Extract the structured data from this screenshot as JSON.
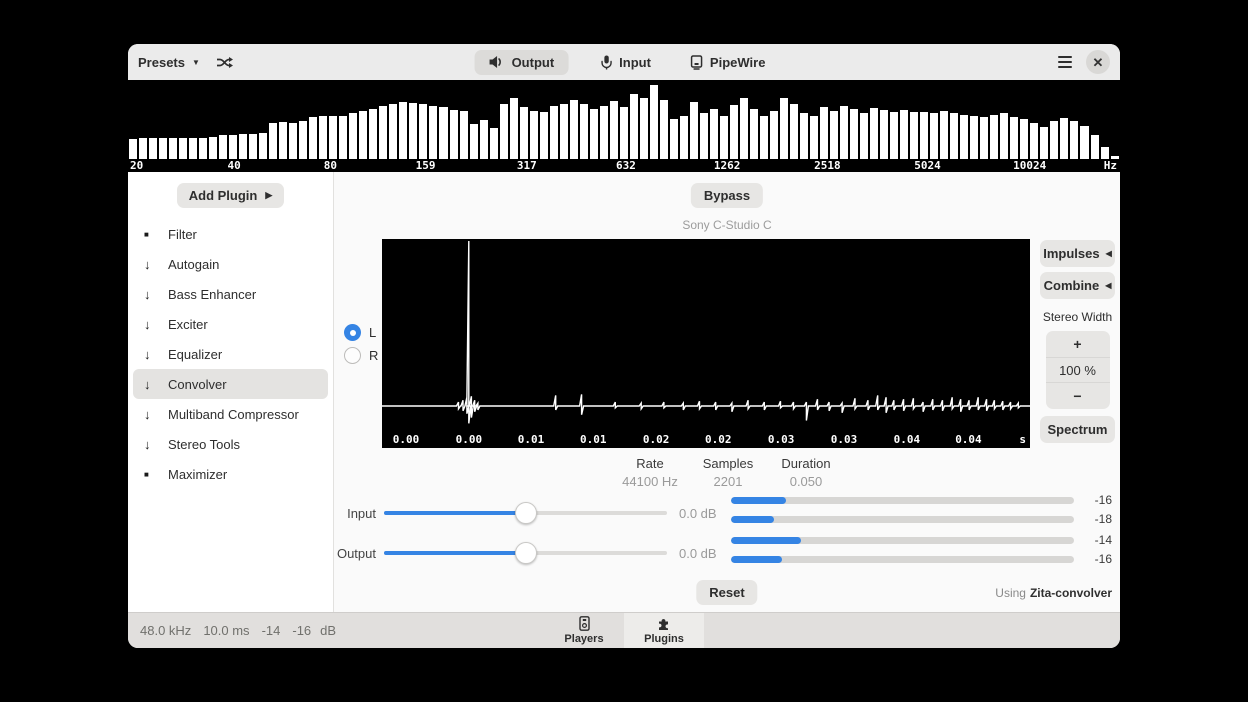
{
  "colors": {
    "accent": "#3584e4",
    "bar_fill": "#ffffff"
  },
  "header": {
    "presets_label": "Presets",
    "tabs": [
      {
        "label": "Output",
        "icon": "speaker-icon",
        "selected": true
      },
      {
        "label": "Input",
        "icon": "microphone-icon",
        "selected": false
      },
      {
        "label": "PipeWire",
        "icon": "device-icon",
        "selected": false
      }
    ]
  },
  "spectrum": {
    "freq_labels": [
      "20",
      "40",
      "80",
      "159",
      "317",
      "632",
      "1262",
      "2518",
      "5024",
      "10024"
    ],
    "label_positions_pct": [
      0.2,
      10.7,
      20.4,
      30.0,
      40.2,
      50.2,
      60.4,
      70.5,
      80.6,
      90.9
    ],
    "unit": "Hz",
    "bars": [
      0.26,
      0.27,
      0.27,
      0.28,
      0.28,
      0.27,
      0.28,
      0.28,
      0.29,
      0.31,
      0.32,
      0.33,
      0.33,
      0.34,
      0.48,
      0.49,
      0.48,
      0.5,
      0.55,
      0.56,
      0.57,
      0.56,
      0.6,
      0.63,
      0.66,
      0.7,
      0.73,
      0.75,
      0.74,
      0.72,
      0.7,
      0.68,
      0.64,
      0.63,
      0.46,
      0.51,
      0.41,
      0.72,
      0.8,
      0.69,
      0.63,
      0.62,
      0.7,
      0.72,
      0.78,
      0.73,
      0.66,
      0.7,
      0.76,
      0.68,
      0.85,
      0.8,
      0.98,
      0.78,
      0.52,
      0.56,
      0.75,
      0.61,
      0.66,
      0.56,
      0.71,
      0.8,
      0.66,
      0.56,
      0.63,
      0.8,
      0.73,
      0.61,
      0.56,
      0.68,
      0.63,
      0.7,
      0.66,
      0.61,
      0.67,
      0.64,
      0.62,
      0.64,
      0.62,
      0.62,
      0.6,
      0.63,
      0.6,
      0.58,
      0.56,
      0.55,
      0.58,
      0.6,
      0.55,
      0.52,
      0.48,
      0.42,
      0.5,
      0.54,
      0.5,
      0.44,
      0.32,
      0.16,
      0.04
    ]
  },
  "sidebar": {
    "add_plugin_label": "Add Plugin",
    "items": [
      {
        "label": "Filter",
        "icon": "square",
        "selected": false
      },
      {
        "label": "Autogain",
        "icon": "arrow-down",
        "selected": false
      },
      {
        "label": "Bass Enhancer",
        "icon": "arrow-down",
        "selected": false
      },
      {
        "label": "Exciter",
        "icon": "arrow-down",
        "selected": false
      },
      {
        "label": "Equalizer",
        "icon": "arrow-down",
        "selected": false
      },
      {
        "label": "Convolver",
        "icon": "arrow-down",
        "selected": true
      },
      {
        "label": "Multiband Compressor",
        "icon": "arrow-down",
        "selected": false
      },
      {
        "label": "Stereo Tools",
        "icon": "arrow-down",
        "selected": false
      },
      {
        "label": "Maximizer",
        "icon": "square",
        "selected": false
      }
    ]
  },
  "main": {
    "bypass_label": "Bypass",
    "preset_name": "Sony C-Studio C",
    "channels": [
      {
        "label": "L",
        "selected": true
      },
      {
        "label": "R",
        "selected": false
      }
    ],
    "waveform": {
      "time_labels": [
        "0.00",
        "0.00",
        "0.01",
        "0.01",
        "0.02",
        "0.02",
        "0.03",
        "0.03",
        "0.04",
        "0.04"
      ],
      "label_positions_pct": [
        3.7,
        13.4,
        23.0,
        32.6,
        42.3,
        51.9,
        61.6,
        71.3,
        81.0,
        90.5
      ],
      "unit": "s",
      "baseline_frac": 0.865,
      "spikes": [
        [
          0.118,
          0.02,
          0.015
        ],
        [
          0.125,
          0.03,
          0.025
        ],
        [
          0.131,
          0.045,
          0.04
        ],
        [
          0.134,
          0.855,
          0.09
        ],
        [
          0.138,
          0.05,
          0.06
        ],
        [
          0.143,
          0.03,
          0.03
        ],
        [
          0.148,
          0.015,
          0.02
        ],
        [
          0.268,
          0.055,
          0.02
        ],
        [
          0.308,
          0.06,
          0.045
        ],
        [
          0.36,
          0.02,
          0.01
        ],
        [
          0.4,
          0.015,
          0.015
        ],
        [
          0.435,
          0.02,
          0.01
        ],
        [
          0.465,
          0.015,
          0.02
        ],
        [
          0.49,
          0.025,
          0.015
        ],
        [
          0.515,
          0.02,
          0.02
        ],
        [
          0.54,
          0.015,
          0.03
        ],
        [
          0.565,
          0.03,
          0.015
        ],
        [
          0.59,
          0.02,
          0.02
        ],
        [
          0.615,
          0.025,
          0.01
        ],
        [
          0.635,
          0.02,
          0.015
        ],
        [
          0.655,
          0.02,
          0.075
        ],
        [
          0.672,
          0.035,
          0.02
        ],
        [
          0.69,
          0.02,
          0.025
        ],
        [
          0.71,
          0.015,
          0.035
        ],
        [
          0.73,
          0.04,
          0.015
        ],
        [
          0.75,
          0.03,
          0.02
        ],
        [
          0.765,
          0.055,
          0.02
        ],
        [
          0.778,
          0.045,
          0.035
        ],
        [
          0.79,
          0.03,
          0.02
        ],
        [
          0.805,
          0.035,
          0.025
        ],
        [
          0.82,
          0.04,
          0.015
        ],
        [
          0.835,
          0.02,
          0.03
        ],
        [
          0.85,
          0.035,
          0.02
        ],
        [
          0.865,
          0.03,
          0.025
        ],
        [
          0.88,
          0.045,
          0.015
        ],
        [
          0.893,
          0.035,
          0.03
        ],
        [
          0.906,
          0.03,
          0.02
        ],
        [
          0.92,
          0.045,
          0.02
        ],
        [
          0.933,
          0.035,
          0.025
        ],
        [
          0.945,
          0.03,
          0.015
        ],
        [
          0.958,
          0.025,
          0.02
        ],
        [
          0.97,
          0.02,
          0.015
        ],
        [
          0.982,
          0.015,
          0.01
        ]
      ]
    },
    "right_panel": {
      "impulses_label": "Impulses",
      "combine_label": "Combine",
      "stereo_width_label": "Stereo Width",
      "plus_label": "+",
      "stereo_width_value": "100 %",
      "minus_label": "−",
      "spectrum_label": "Spectrum"
    },
    "info": {
      "rate_label": "Rate",
      "rate_value": "44100 Hz",
      "samples_label": "Samples",
      "samples_value": "2201",
      "duration_label": "Duration",
      "duration_value": "0.050"
    },
    "gain": {
      "input_label": "Input",
      "input_value": "0.0 dB",
      "input_slider_pct": 50,
      "output_label": "Output",
      "output_value": "0.0 dB",
      "output_slider_pct": 50,
      "meters": {
        "input": [
          {
            "pct": 16,
            "db": "-16"
          },
          {
            "pct": 12.5,
            "db": "-18"
          }
        ],
        "output": [
          {
            "pct": 20.5,
            "db": "-14"
          },
          {
            "pct": 15,
            "db": "-16"
          }
        ]
      }
    },
    "reset_label": "Reset",
    "using_label": "Using",
    "engine_name": "Zita-convolver"
  },
  "statusbar": {
    "sample_rate": "48.0 kHz",
    "latency": "10.0 ms",
    "level_left": "-14",
    "level_right": "-16",
    "unit": "dB",
    "tabs": [
      {
        "label": "Players",
        "icon": "media-player-icon",
        "selected": false
      },
      {
        "label": "Plugins",
        "icon": "puzzle-piece-icon",
        "selected": true
      }
    ]
  }
}
